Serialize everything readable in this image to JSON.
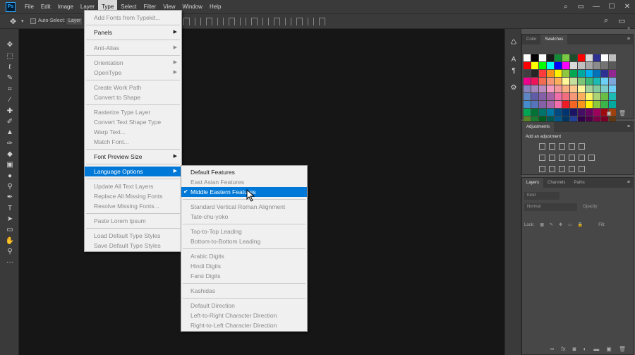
{
  "app": {
    "logo": "Ps"
  },
  "menubar": {
    "items": [
      "File",
      "Edit",
      "Image",
      "Layer",
      "Type",
      "Select",
      "Filter",
      "View",
      "Window",
      "Help"
    ],
    "active": "Type"
  },
  "window_controls": {
    "minimize": "—",
    "maximize": "☐",
    "close": "✕"
  },
  "options_bar": {
    "auto_select_label": "Auto-Select:",
    "auto_select_value": "Layer"
  },
  "type_menu": {
    "items": [
      {
        "label": "Add Fonts from Typekit...",
        "enabled": false
      },
      {
        "label": "Panels",
        "enabled": true,
        "submenu": true
      },
      {
        "label": "Anti-Alias",
        "enabled": false,
        "submenu": true
      },
      {
        "label": "Orientation",
        "enabled": false,
        "submenu": true
      },
      {
        "label": "OpenType",
        "enabled": false,
        "submenu": true
      },
      {
        "label": "Create Work Path",
        "enabled": false
      },
      {
        "label": "Convert to Shape",
        "enabled": false
      },
      {
        "label": "Rasterize Type Layer",
        "enabled": false
      },
      {
        "label": "Convert Text Shape Type",
        "enabled": false
      },
      {
        "label": "Warp Text...",
        "enabled": false
      },
      {
        "label": "Match Font...",
        "enabled": false
      },
      {
        "label": "Font Preview Size",
        "enabled": true,
        "submenu": true
      },
      {
        "label": "Language Options",
        "enabled": true,
        "submenu": true,
        "highlighted": true
      },
      {
        "label": "Update All Text Layers",
        "enabled": false
      },
      {
        "label": "Replace All Missing Fonts",
        "enabled": false
      },
      {
        "label": "Resolve Missing Fonts...",
        "enabled": false
      },
      {
        "label": "Paste Lorem Ipsum",
        "enabled": false
      },
      {
        "label": "Load Default Type Styles",
        "enabled": false
      },
      {
        "label": "Save Default Type Styles",
        "enabled": false
      }
    ]
  },
  "language_menu": {
    "items": [
      {
        "label": "Default Features",
        "enabled": true
      },
      {
        "label": "East Asian Features",
        "enabled": false
      },
      {
        "label": "Middle Eastern Features",
        "enabled": true,
        "checked": true,
        "highlighted": true
      },
      {
        "label": "Standard Vertical Roman Alignment",
        "enabled": false
      },
      {
        "label": "Tate-chu-yoko",
        "enabled": false
      },
      {
        "label": "Top-to-Top Leading",
        "enabled": false
      },
      {
        "label": "Bottom-to-Bottom Leading",
        "enabled": false
      },
      {
        "label": "Arabic Digits",
        "enabled": false
      },
      {
        "label": "Hindi Digits",
        "enabled": false
      },
      {
        "label": "Farsi Digits",
        "enabled": false
      },
      {
        "label": "Kashidas",
        "enabled": false
      },
      {
        "label": "Default Direction",
        "enabled": false
      },
      {
        "label": "Left-to-Right Character Direction",
        "enabled": false
      },
      {
        "label": "Right-to-Left Character Direction",
        "enabled": false
      }
    ]
  },
  "panels": {
    "color_tabs": {
      "color": "Color",
      "swatches": "Swatches"
    },
    "adjustments": {
      "title": "Adjustments",
      "subtitle": "Add an adjustment"
    },
    "layers_tabs": {
      "layers": "Layers",
      "channels": "Channels",
      "paths": "Paths"
    },
    "layers": {
      "kind_placeholder": "Kind",
      "blend_mode": "Normal",
      "opacity_label": "Opacity:",
      "lock_label": "Lock:",
      "fill_label": "Fill:"
    }
  },
  "swatches": [
    "#ffffff",
    "#000000",
    "#ffffff",
    "#1a1a1a",
    "#138a36",
    "#7ac943",
    "#1e4d2b",
    "#ff0000",
    "#d9d9d9",
    "#2e3192",
    "#ffffff",
    "#bfbfbf",
    "#ff0000",
    "#ffff00",
    "#00ff00",
    "#00ffff",
    "#0000ff",
    "#ff00ff",
    "#d9d9d9",
    "#c0c0c0",
    "#a6a6a6",
    "#8c8c8c",
    "#737373",
    "#595959",
    "#404040",
    "#262626",
    "#ff3b3b",
    "#f7941d",
    "#fff200",
    "#8dc63f",
    "#00a651",
    "#00a99d",
    "#00aeef",
    "#0072bc",
    "#2e3192",
    "#92278f",
    "#ec008c",
    "#ed145b",
    "#f26c4f",
    "#f69679",
    "#fbaf5d",
    "#fff799",
    "#c4df9b",
    "#7cc576",
    "#3bb878",
    "#1abbb4",
    "#6dcff6",
    "#7da7d9",
    "#8781bd",
    "#a186be",
    "#bd8cbf",
    "#f49ac1",
    "#f5989d",
    "#f9ad81",
    "#fdc68a",
    "#fff79a",
    "#a3d39c",
    "#82ca9c",
    "#7accc8",
    "#6ecff6",
    "#5e85c4",
    "#605ca8",
    "#8560a8",
    "#a763a8",
    "#f06eaa",
    "#f26d7d",
    "#f7977a",
    "#fbaf5d",
    "#fff568",
    "#acd373",
    "#68bd45",
    "#1cbbb4",
    "#448ccb",
    "#5674b9",
    "#855fa8",
    "#a864a8",
    "#f06eaa",
    "#ed1c24",
    "#f26522",
    "#f7941d",
    "#fff200",
    "#8dc63f",
    "#39b54a",
    "#00a99d",
    "#00a651",
    "#007236",
    "#00746b",
    "#0076a3",
    "#004a80",
    "#003471",
    "#1b1464",
    "#440e62",
    "#630460",
    "#9e005d",
    "#9e0b0f",
    "#a0410d",
    "#598527",
    "#197b30",
    "#005e20",
    "#005952",
    "#00588a",
    "#003663",
    "#21409a",
    "#32004b",
    "#4b0049",
    "#7b0046",
    "#7a0026",
    "#603913"
  ]
}
